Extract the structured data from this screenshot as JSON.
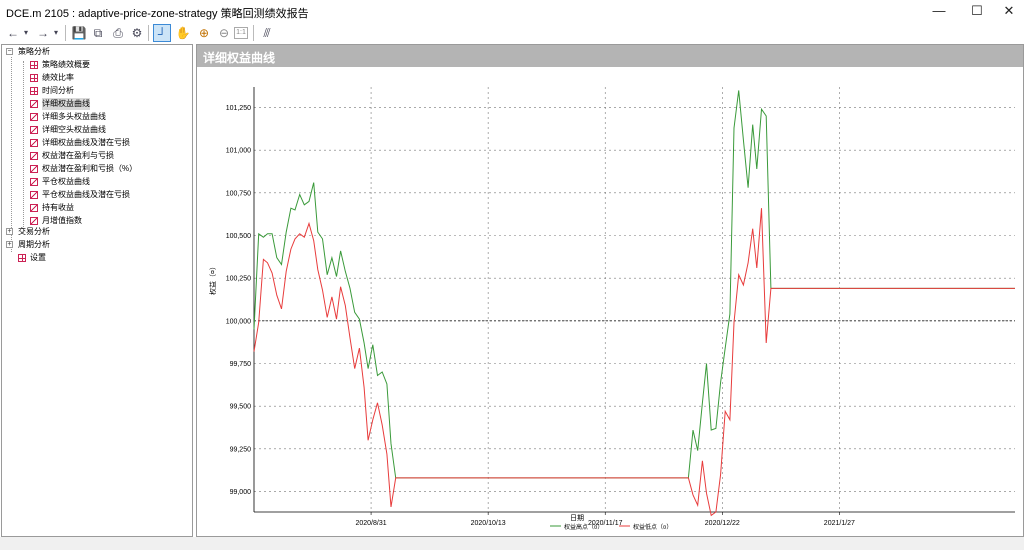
{
  "window": {
    "title": "DCE.m 2105 : adaptive-price-zone-strategy 策略回测绩效报告",
    "minimize_glyph": "—",
    "maximize_glyph": "☐",
    "close_glyph": "✕"
  },
  "toolbar": {
    "back_glyph": "←",
    "forward_glyph": "→",
    "dropdown_glyph": "▾",
    "save_glyph": "💾",
    "copy_glyph": "⧉",
    "print_glyph": "⎙",
    "settings_glyph": "⚙",
    "crosshair_glyph": "┘",
    "hand_glyph": "✋",
    "zoom_in_glyph": "⊕",
    "zoom_out_glyph": "⊖",
    "zoom_fit_glyph": "1:1",
    "export_glyph": "⫻"
  },
  "tree": {
    "root": "策略分析",
    "items": [
      {
        "label": "策略绩效概要",
        "icon": "grid-icon"
      },
      {
        "label": "绩效比率",
        "icon": "grid-icon"
      },
      {
        "label": "时间分析",
        "icon": "grid-icon"
      },
      {
        "label": "详细权益曲线",
        "icon": "chart-icon"
      },
      {
        "label": "详细多头权益曲线",
        "icon": "chart-icon"
      },
      {
        "label": "详细空头权益曲线",
        "icon": "chart-icon"
      },
      {
        "label": "详细权益曲线及潜在亏损",
        "icon": "chart-icon"
      },
      {
        "label": "权益潜在盈利与亏损",
        "icon": "chart-icon"
      },
      {
        "label": "权益潜在盈利和亏损（%）",
        "icon": "chart-icon"
      },
      {
        "label": "平仓权益曲线",
        "icon": "chart-icon"
      },
      {
        "label": "平仓权益曲线及潜在亏损",
        "icon": "chart-icon"
      },
      {
        "label": "持有收益",
        "icon": "chart-icon"
      },
      {
        "label": "月增值指数",
        "icon": "chart-icon"
      }
    ],
    "trade_analysis": "交易分析",
    "period_analysis": "周期分析",
    "settings": "设置"
  },
  "panel": {
    "title": "详细权益曲线"
  },
  "chart_data": {
    "type": "line",
    "xlabel": "日期",
    "ylabel": "权益（¤）",
    "ylim": [
      98880,
      101370
    ],
    "baseline": 100000,
    "grid": true,
    "legend_position": "bottom-center",
    "y_ticks": [
      {
        "value": 99000,
        "label": "99,000"
      },
      {
        "value": 99250,
        "label": "99,250"
      },
      {
        "value": 99500,
        "label": "99,500"
      },
      {
        "value": 99750,
        "label": "99,750"
      },
      {
        "value": 100000,
        "label": "100,000"
      },
      {
        "value": 100250,
        "label": "100,250"
      },
      {
        "value": 100500,
        "label": "100,500"
      },
      {
        "value": 100750,
        "label": "100,750"
      },
      {
        "value": 101000,
        "label": "101,000"
      },
      {
        "value": 101250,
        "label": "101,250"
      }
    ],
    "x_ticks": [
      {
        "x": 0.2,
        "label": "2020/8/31"
      },
      {
        "x": 0.4,
        "label": "2020/10/13"
      },
      {
        "x": 0.6,
        "label": "2020/11/17"
      },
      {
        "x": 0.8,
        "label": "2020/12/22"
      },
      {
        "x": 1.0,
        "label": "2021/1/27"
      }
    ],
    "series": [
      {
        "name": "权益高点（¤）",
        "color": "#3a9a3a",
        "x": [
          0,
          0.008,
          0.016,
          0.023,
          0.031,
          0.039,
          0.047,
          0.055,
          0.063,
          0.07,
          0.078,
          0.086,
          0.094,
          0.102,
          0.109,
          0.117,
          0.125,
          0.133,
          0.141,
          0.148,
          0.156,
          0.164,
          0.172,
          0.18,
          0.188,
          0.195,
          0.203,
          0.211,
          0.219,
          0.227,
          0.234,
          0.242,
          0.25,
          0.258,
          0.734,
          0.742,
          0.75,
          0.758,
          0.766,
          0.773,
          0.781,
          0.789,
          0.797,
          0.805,
          0.813,
          0.82,
          0.828,
          0.836,
          0.844,
          0.852,
          0.859,
          0.867,
          0.875,
          0.883,
          0.891,
          1.3
        ],
        "y": [
          99950,
          100510,
          100490,
          100510,
          100510,
          100370,
          100330,
          100520,
          100660,
          100650,
          100740,
          100680,
          100700,
          100810,
          100520,
          100480,
          100270,
          100370,
          100260,
          100410,
          100290,
          100190,
          100050,
          100010,
          99870,
          99720,
          99860,
          99680,
          99700,
          99630,
          99280,
          99080,
          99080,
          99080,
          99080,
          99080,
          99360,
          99240,
          99520,
          99750,
          99360,
          99370,
          99640,
          99840,
          100040,
          101130,
          101350,
          101060,
          100780,
          101150,
          100890,
          101240,
          101200,
          100190,
          100190,
          100190
        ]
      },
      {
        "name": "权益低点（¤）",
        "color": "#e83c3c",
        "x": [
          0,
          0.008,
          0.016,
          0.023,
          0.031,
          0.039,
          0.047,
          0.055,
          0.063,
          0.07,
          0.078,
          0.086,
          0.094,
          0.102,
          0.109,
          0.117,
          0.125,
          0.133,
          0.141,
          0.148,
          0.156,
          0.164,
          0.172,
          0.18,
          0.188,
          0.195,
          0.203,
          0.211,
          0.219,
          0.227,
          0.234,
          0.242,
          0.25,
          0.258,
          0.734,
          0.742,
          0.75,
          0.758,
          0.766,
          0.773,
          0.781,
          0.789,
          0.797,
          0.805,
          0.813,
          0.82,
          0.828,
          0.836,
          0.844,
          0.852,
          0.859,
          0.867,
          0.875,
          0.883,
          0.891,
          1.3
        ],
        "y": [
          99820,
          99990,
          100360,
          100340,
          100280,
          100150,
          100070,
          100290,
          100420,
          100480,
          100510,
          100490,
          100570,
          100470,
          100300,
          100180,
          100020,
          100140,
          100010,
          100200,
          100090,
          99900,
          99720,
          99840,
          99610,
          99300,
          99420,
          99520,
          99390,
          99220,
          98910,
          99080,
          99080,
          99080,
          99080,
          99080,
          98980,
          98920,
          99180,
          98990,
          98860,
          98880,
          99100,
          99470,
          99420,
          99990,
          100270,
          100210,
          100340,
          100540,
          100310,
          100660,
          99870,
          100190,
          100190,
          100190
        ]
      }
    ]
  }
}
